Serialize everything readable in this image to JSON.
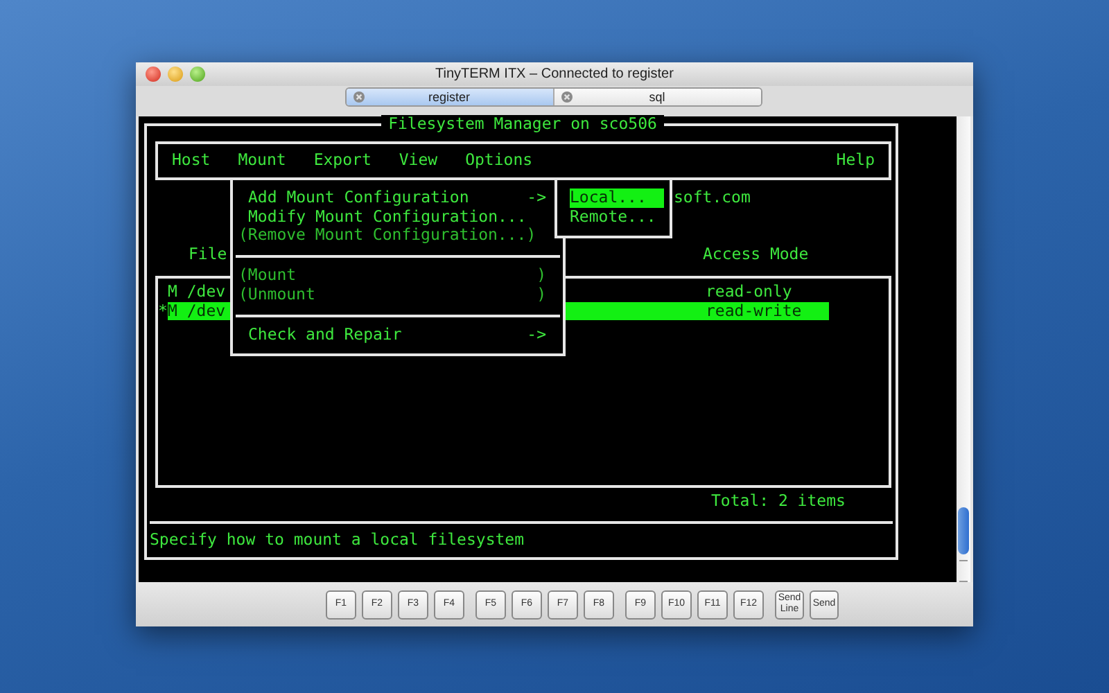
{
  "window": {
    "title": "TinyTERM ITX – Connected to register"
  },
  "tabs": [
    {
      "label": "register",
      "selected": true
    },
    {
      "label": "sql",
      "selected": false
    }
  ],
  "terminal": {
    "title": "Filesystem Manager on sco506",
    "menubar": {
      "items": [
        "Host",
        "Mount",
        "Export",
        "View",
        "Options"
      ],
      "help": "Help"
    },
    "hostname_fragment": "soft.com",
    "columns": [
      "File",
      "Access Mode"
    ],
    "rows": [
      {
        "path": "M /dev",
        "access": "read-only",
        "selected": false
      },
      {
        "marker": "*",
        "path": "M /dev",
        "access": "read-write",
        "selected": true
      }
    ],
    "total": "Total: 2 items",
    "status": "Specify how to mount a local filesystem",
    "menu": {
      "sections": [
        [
          {
            "label": "Add Mount Configuration",
            "right": "->",
            "disabled": false
          },
          {
            "label": "Modify Mount Configuration...",
            "disabled": false
          },
          {
            "label": "(Remove Mount Configuration...)",
            "disabled": true
          }
        ],
        [
          {
            "label": "(Mount",
            "right": ")",
            "disabled": true
          },
          {
            "label": "(Unmount",
            "right": ")",
            "disabled": true
          }
        ],
        [
          {
            "label": "Check and Repair",
            "right": "->",
            "disabled": false
          }
        ]
      ]
    },
    "submenu": [
      {
        "label": "Local...",
        "selected": true
      },
      {
        "label": "Remote...",
        "selected": false
      }
    ]
  },
  "function_keys": [
    "F1",
    "F2",
    "F3",
    "F4",
    "F5",
    "F6",
    "F7",
    "F8",
    "F9",
    "F10",
    "F11",
    "F12"
  ],
  "send_buttons": [
    "Send Line",
    "Send"
  ]
}
